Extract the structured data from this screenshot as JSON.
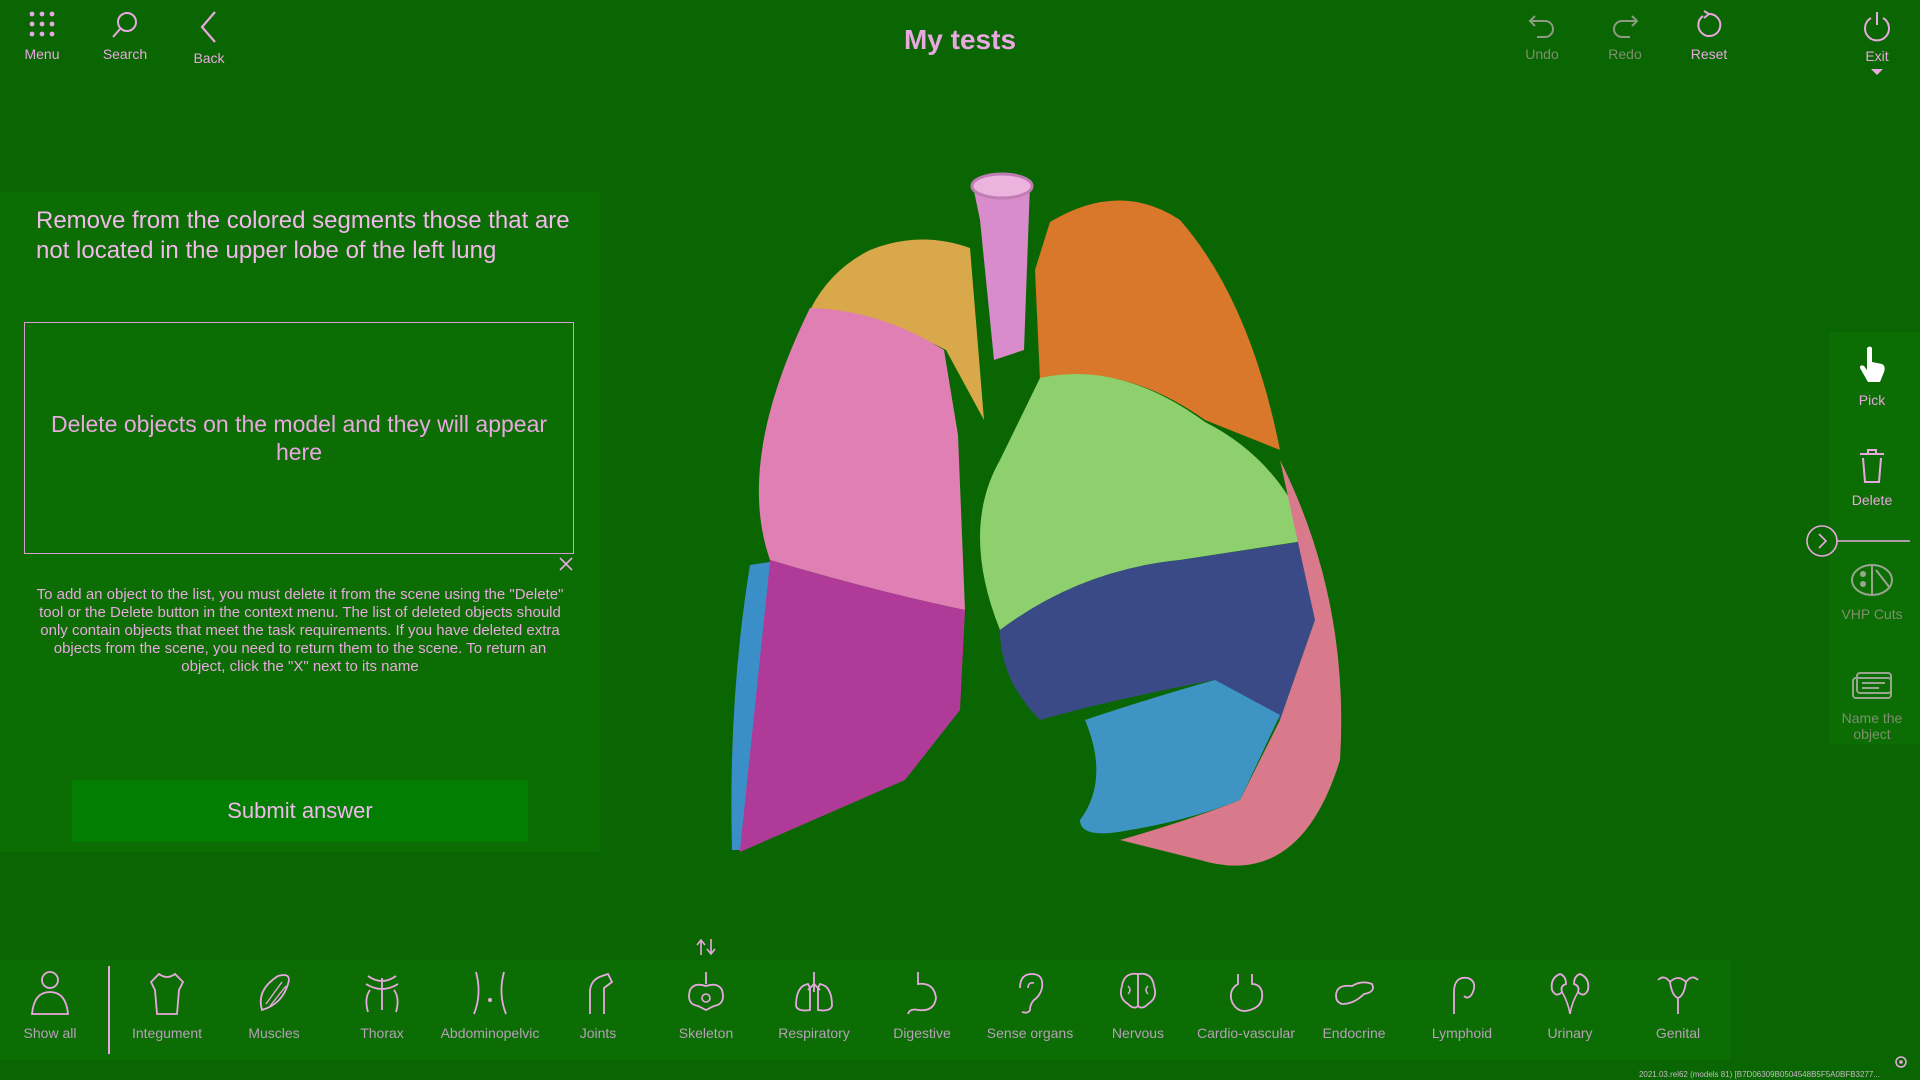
{
  "colors": {
    "background": "#0a6602",
    "text": "#e9a8e0",
    "panel": "#0b6d04",
    "submit_bg": "#027f02",
    "disabled": "#7f8f6f"
  },
  "header": {
    "title": "My tests",
    "left_buttons": [
      {
        "label": "Menu",
        "icon": "grid-menu-icon"
      },
      {
        "label": "Search",
        "icon": "search-icon"
      },
      {
        "label": "Back",
        "icon": "chevron-left-icon"
      }
    ],
    "right_buttons": [
      {
        "label": "Undo",
        "icon": "undo-icon",
        "enabled": false
      },
      {
        "label": "Redo",
        "icon": "redo-icon",
        "enabled": false
      },
      {
        "label": "Reset",
        "icon": "reset-icon",
        "enabled": true
      },
      {
        "label": "Exit",
        "icon": "power-icon",
        "enabled": true
      }
    ]
  },
  "task": {
    "question": "Remove from the colored segments those that are not located in the upper lobe of the left lung",
    "drop_placeholder": "Delete objects on the model and they will appear here",
    "instructions": "To add an object to the list, you must delete it from the scene using the \"Delete\" tool or the Delete button in the context menu. The list of deleted objects should only contain objects that meet the task requirements. If you have deleted extra objects from the scene, you need to return them to the scene. To return an object, click the \"X\" next to its name",
    "submit_label": "Submit answer"
  },
  "right_tools": [
    {
      "label": "Pick",
      "icon": "hand-pointer-icon",
      "active": true
    },
    {
      "label": "Delete",
      "icon": "trash-icon",
      "active": false
    },
    {
      "label": "VHP Cuts",
      "icon": "vhp-cuts-icon",
      "active": false
    },
    {
      "label": "Name the object",
      "icon": "name-object-icon",
      "active": false
    }
  ],
  "systems": [
    {
      "label": "Show all",
      "icon": "person-icon"
    },
    {
      "label": "Integument",
      "icon": "integument-icon"
    },
    {
      "label": "Muscles",
      "icon": "muscle-icon"
    },
    {
      "label": "Thorax",
      "icon": "thorax-icon"
    },
    {
      "label": "Abdominopelvic",
      "icon": "abdominopelvic-icon"
    },
    {
      "label": "Joints",
      "icon": "joint-icon"
    },
    {
      "label": "Skeleton",
      "icon": "skeleton-icon"
    },
    {
      "label": "Respiratory",
      "icon": "lungs-icon"
    },
    {
      "label": "Digestive",
      "icon": "stomach-icon"
    },
    {
      "label": "Sense organs",
      "icon": "ear-icon"
    },
    {
      "label": "Nervous",
      "icon": "brain-icon"
    },
    {
      "label": "Cardio-vascular",
      "icon": "heart-icon"
    },
    {
      "label": "Endocrine",
      "icon": "pancreas-icon"
    },
    {
      "label": "Lymphoid",
      "icon": "lymph-icon"
    },
    {
      "label": "Urinary",
      "icon": "kidney-icon"
    },
    {
      "label": "Genital",
      "icon": "uterus-icon"
    }
  ],
  "version": "2021.03.rel62 (models 81) [B7D06309B0504548B5F5A0BFB3277..."
}
